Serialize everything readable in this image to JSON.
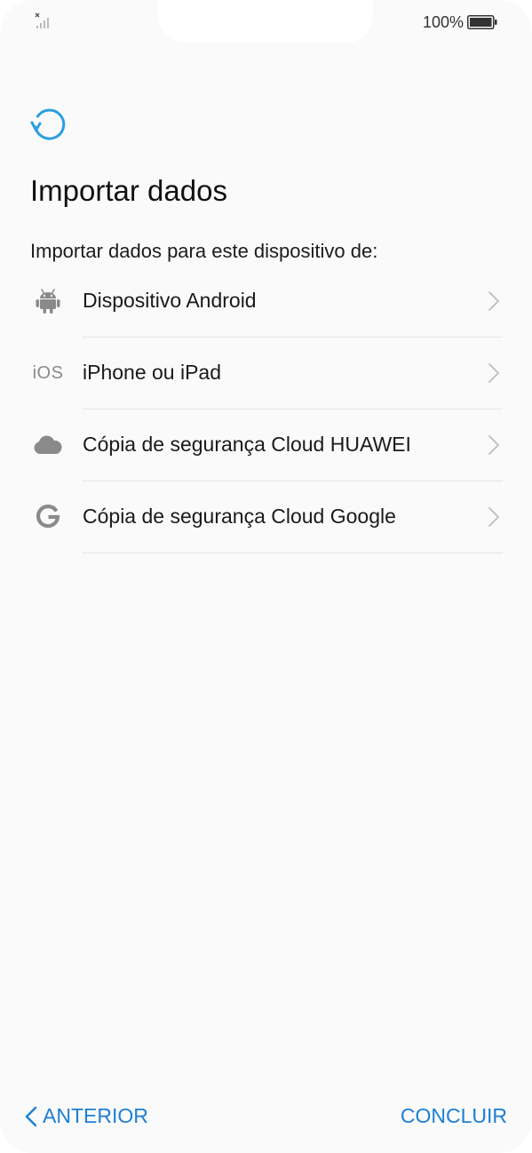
{
  "status_bar": {
    "battery_text": "100%",
    "battery_level_percent": 100
  },
  "header": {
    "title": "Importar dados",
    "subtitle": "Importar dados para este dispositivo de:"
  },
  "options": [
    {
      "label": "Dispositivo Android",
      "icon": "android-icon"
    },
    {
      "label": "iPhone ou iPad",
      "icon": "ios-icon",
      "icon_text": "iOS"
    },
    {
      "label": "Cópia de segurança Cloud HUAWEI",
      "icon": "cloud-icon"
    },
    {
      "label": "Cópia de segurança Cloud Google",
      "icon": "google-icon"
    }
  ],
  "footer": {
    "back_label": "ANTERIOR",
    "finish_label": "CONCLUIR"
  },
  "colors": {
    "accent": "#1c7fd4",
    "sync_icon": "#2a9fe0",
    "icon_gray": "#8a8a8a"
  }
}
